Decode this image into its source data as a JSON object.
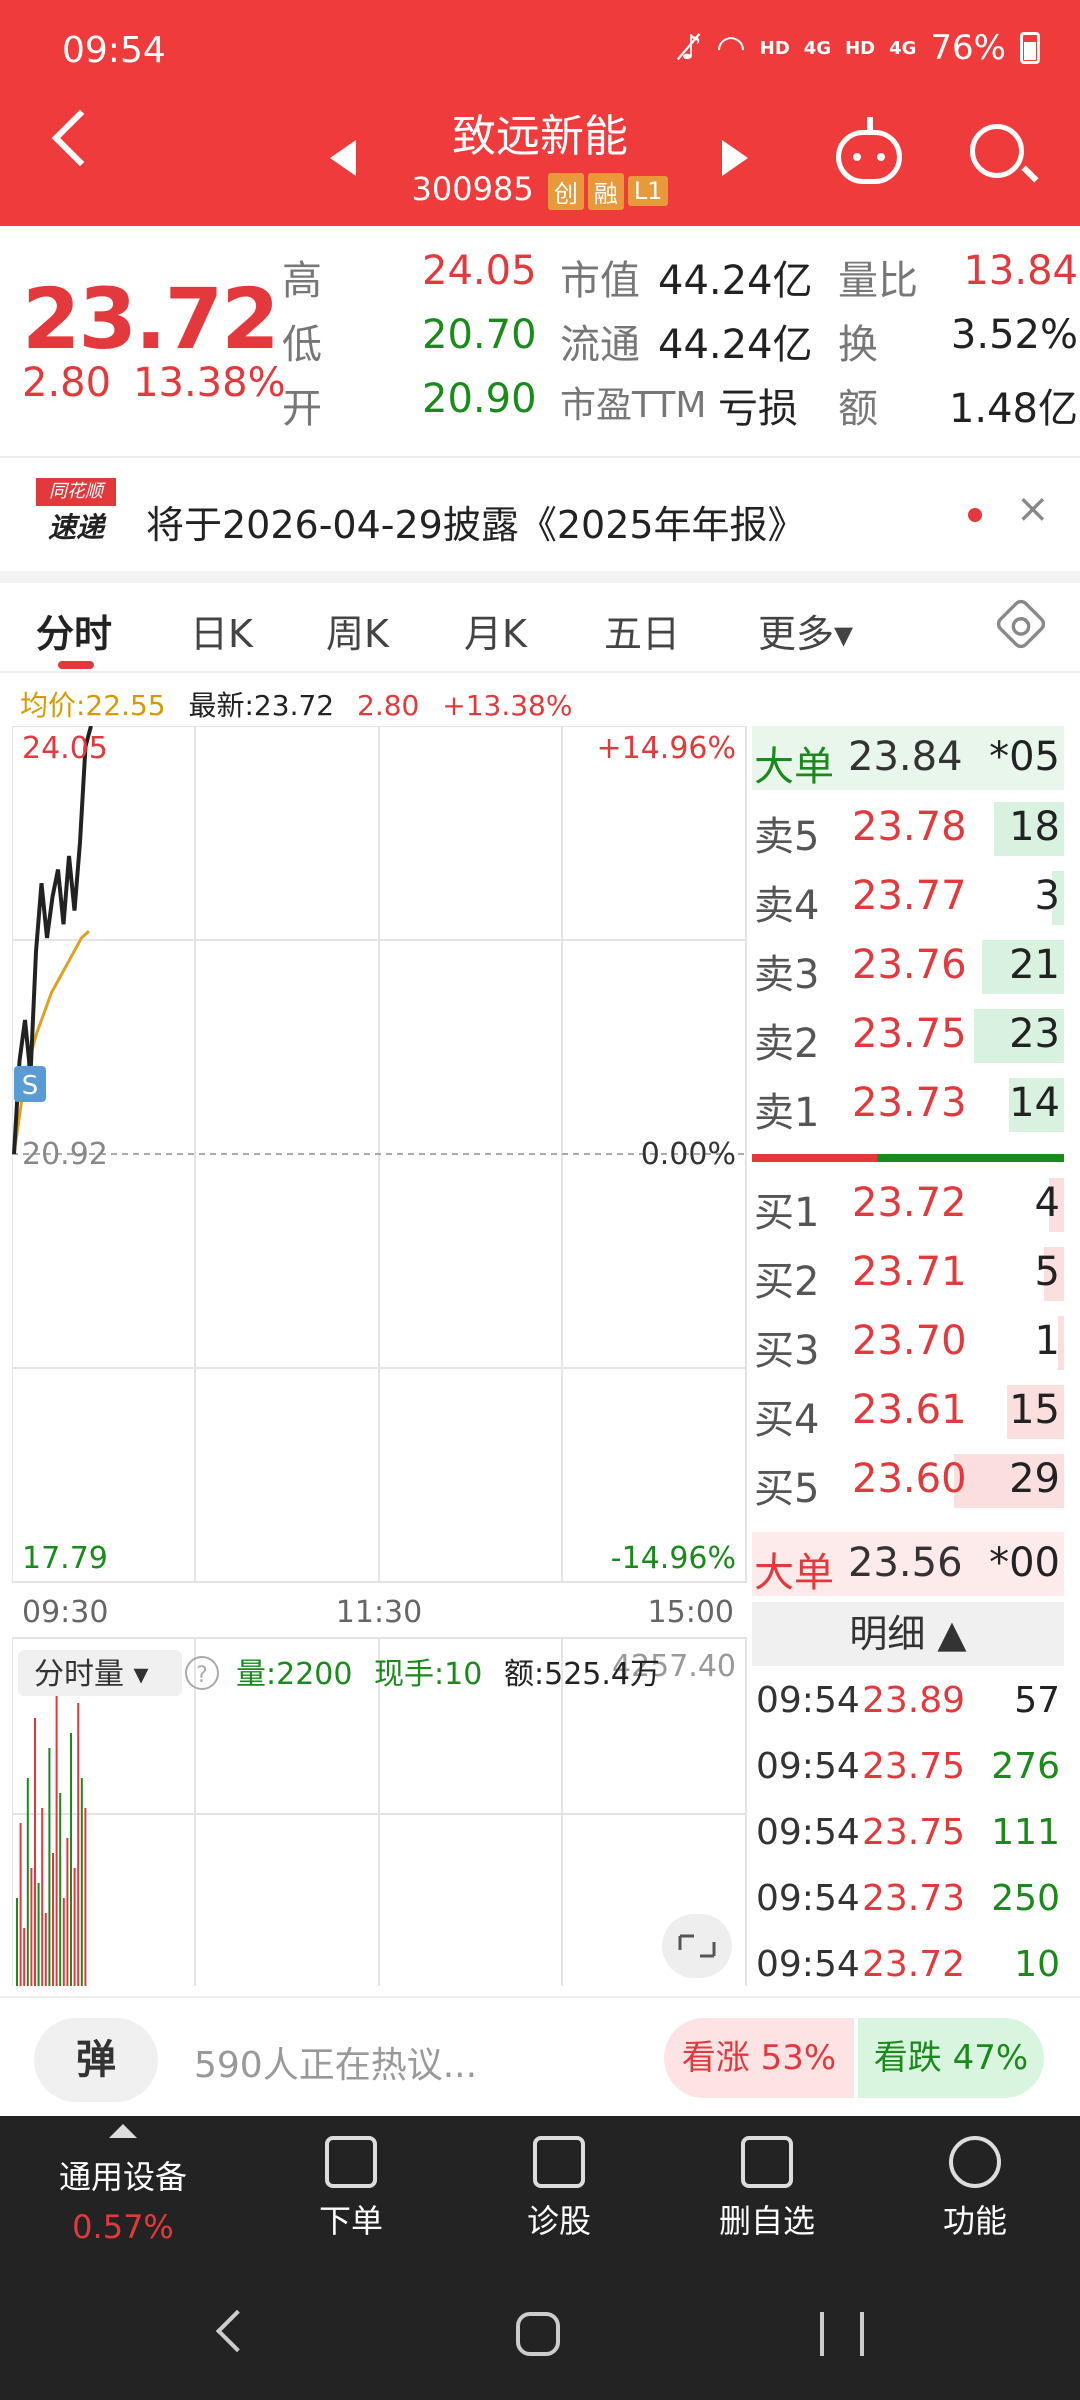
{
  "status_bar": {
    "time": "09:54",
    "battery": "76%",
    "sig1": "HD",
    "sig2": "4G",
    "sig3": "HD",
    "sig4": "4G"
  },
  "header": {
    "name": "致远新能",
    "code": "300985",
    "tags": [
      "创",
      "融",
      "L1"
    ]
  },
  "quote": {
    "price": "23.72",
    "change": "2.80",
    "change_pct": "13.38%",
    "high_label": "高",
    "high": "24.05",
    "low_label": "低",
    "low": "20.70",
    "open_label": "开",
    "open": "20.90",
    "mcap_label": "市值",
    "mcap": "44.24亿",
    "float_label": "流通",
    "float": "44.24亿",
    "pe_label": "市盈TTM",
    "pe": "亏损",
    "vr_label": "量比",
    "vr": "13.84",
    "turn_label": "换",
    "turn": "3.52%",
    "amt_label": "额",
    "amt": "1.48亿"
  },
  "notice": {
    "logo_top": "同花顺",
    "logo_bottom": "速递",
    "text": "将于2026-04-29披露《2025年年报》",
    "close": "×"
  },
  "tabs": [
    "分时",
    "日K",
    "周K",
    "月K",
    "五日",
    "更多▾"
  ],
  "info_row": {
    "avg": "均价:22.55",
    "latest": "最新:23.72",
    "chg": "2.80",
    "pct": "+13.38%"
  },
  "chart": {
    "top_price": "24.05",
    "top_pct": "+14.96%",
    "base_price": "20.92",
    "base_pct": "0.00%",
    "bottom_price": "17.79",
    "bottom_pct": "-14.96%",
    "times": [
      "09:30",
      "11:30",
      "15:00"
    ],
    "s_marker": "S",
    "vol_selector": "分时量 ▾",
    "vol": "量:2200",
    "hand": "现手:10",
    "amount": "额:525.4万",
    "vol_max": "4257.40"
  },
  "chart_data": {
    "type": "line",
    "ylim": [
      17.79,
      24.05
    ],
    "series": [
      {
        "values": [
          20.92,
          21.6,
          21.9,
          21.5,
          22.4,
          22.9,
          22.5,
          22.8,
          23.0,
          22.6,
          23.1,
          22.7,
          23.2,
          23.9,
          24.05
        ]
      },
      {
        "values": [
          20.92,
          21.3,
          21.6,
          21.8,
          21.95,
          22.1,
          22.2,
          22.3,
          22.4,
          22.5,
          22.55
        ]
      }
    ],
    "volume": [
      30,
      55,
      20,
      70,
      40,
      90,
      35,
      60,
      25,
      80,
      45,
      100,
      65,
      30,
      50,
      85,
      40,
      95,
      70,
      60
    ]
  },
  "book": {
    "big_sell": {
      "label": "大单",
      "price": "23.84",
      "qty": "*05"
    },
    "asks": [
      {
        "label": "卖5",
        "price": "23.78",
        "qty": "18",
        "w": 0.64
      },
      {
        "label": "卖4",
        "price": "23.77",
        "qty": "3",
        "w": 0.11
      },
      {
        "label": "卖3",
        "price": "23.76",
        "qty": "21",
        "w": 0.75
      },
      {
        "label": "卖2",
        "price": "23.75",
        "qty": "23",
        "w": 0.82
      },
      {
        "label": "卖1",
        "price": "23.73",
        "qty": "14",
        "w": 0.5
      }
    ],
    "bids": [
      {
        "label": "买1",
        "price": "23.72",
        "qty": "4",
        "w": 0.14
      },
      {
        "label": "买2",
        "price": "23.71",
        "qty": "5",
        "w": 0.18
      },
      {
        "label": "买3",
        "price": "23.70",
        "qty": "1",
        "w": 0.04
      },
      {
        "label": "买4",
        "price": "23.61",
        "qty": "15",
        "w": 0.52
      },
      {
        "label": "买5",
        "price": "23.60",
        "qty": "29",
        "w": 1.0
      }
    ],
    "big_buy": {
      "label": "大单",
      "price": "23.56",
      "qty": "*00"
    },
    "detail_label": "明细 ▲",
    "ticks": [
      {
        "t": "09:54",
        "p": "23.89",
        "v": "57",
        "c": "#222"
      },
      {
        "t": "09:54",
        "p": "23.75",
        "v": "276",
        "c": "#1a8a1a"
      },
      {
        "t": "09:54",
        "p": "23.75",
        "v": "111",
        "c": "#1a8a1a"
      },
      {
        "t": "09:54",
        "p": "23.73",
        "v": "250",
        "c": "#1a8a1a"
      },
      {
        "t": "09:54",
        "p": "23.72",
        "v": "10",
        "c": "#1a8a1a"
      }
    ]
  },
  "comment": {
    "danmu": "弹",
    "text": "590人正在热议...",
    "bull": "看涨 53%",
    "bear": "看跌 47%"
  },
  "toolbar": {
    "device": "通用设备",
    "device_pct": "0.57%",
    "order": "下单",
    "diagnose": "诊股",
    "remove": "删自选",
    "func": "功能"
  },
  "colors": {
    "red": "#e4393c",
    "green": "#1a8a1a",
    "header": "#ef3b3b"
  }
}
